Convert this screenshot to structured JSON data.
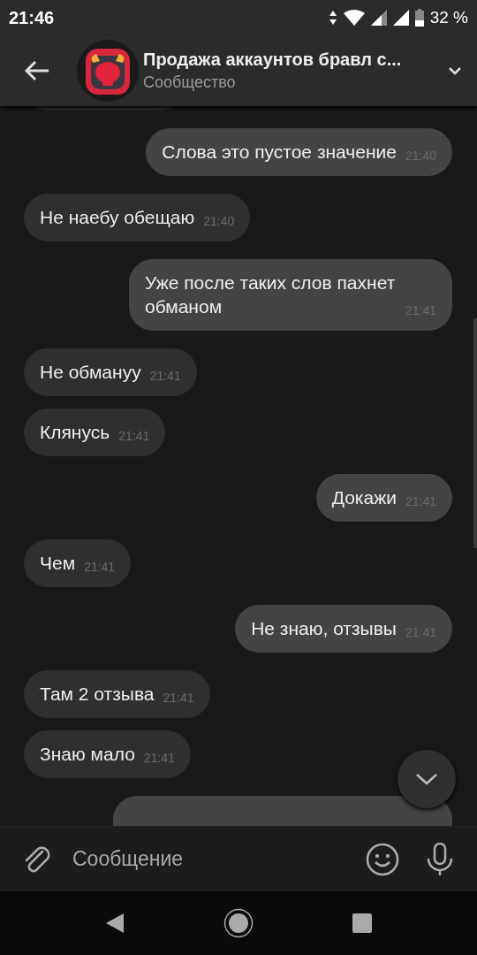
{
  "status_bar": {
    "time": "21:46",
    "battery": "32 %"
  },
  "header": {
    "title": "Продажа аккаунтов бравл с...",
    "subtitle": "Сообщество"
  },
  "messages": [
    {
      "kind": "outgoing",
      "text": "Слова это пустое значение",
      "time": "21:40"
    },
    {
      "kind": "incoming",
      "text": "Не наебу обещаю",
      "time": "21:40"
    },
    {
      "kind": "outgoing",
      "text": "Уже после таких слов пахнет обманом",
      "time": "21:41"
    },
    {
      "kind": "incoming",
      "text": "Не обмануу",
      "time": "21:41"
    },
    {
      "kind": "incoming",
      "text": "Клянусь",
      "time": "21:41"
    },
    {
      "kind": "outgoing",
      "text": "Докажи",
      "time": "21:41"
    },
    {
      "kind": "incoming",
      "text": "Чем",
      "time": "21:41"
    },
    {
      "kind": "outgoing",
      "text": "Не знаю, отзывы",
      "time": "21:41"
    },
    {
      "kind": "incoming",
      "text": "Там 2 отзыва",
      "time": "21:41"
    },
    {
      "kind": "incoming",
      "text": "Знаю мало",
      "time": "21:41"
    },
    {
      "kind": "outgoing"
    }
  ],
  "composer": {
    "placeholder": "Сообщение"
  }
}
